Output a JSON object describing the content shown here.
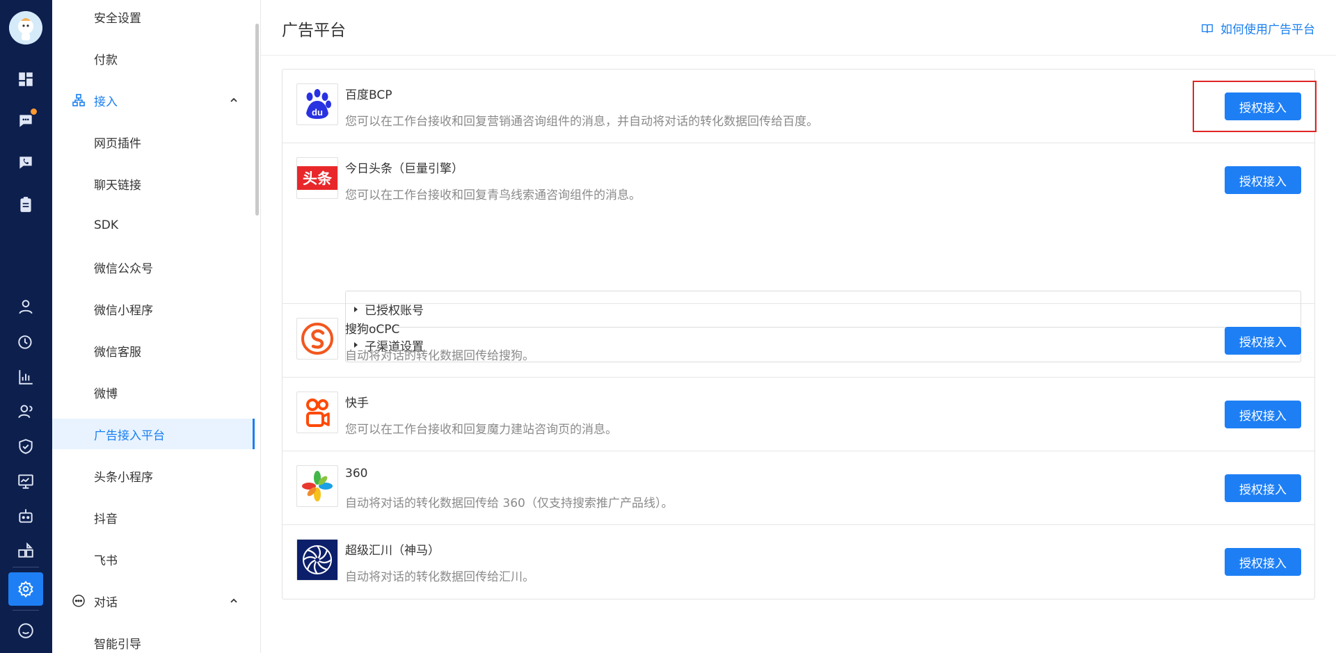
{
  "page": {
    "title": "广告平台",
    "help_link": "如何使用广告平台"
  },
  "sidebar": {
    "items": [
      {
        "label": "安全设置"
      },
      {
        "label": "付款"
      },
      {
        "label": "接入"
      },
      {
        "label": "网页插件"
      },
      {
        "label": "聊天链接"
      },
      {
        "label": "SDK"
      },
      {
        "label": "微信公众号"
      },
      {
        "label": "微信小程序"
      },
      {
        "label": "微信客服"
      },
      {
        "label": "微博"
      },
      {
        "label": "广告接入平台"
      },
      {
        "label": "头条小程序"
      },
      {
        "label": "抖音"
      },
      {
        "label": "飞书"
      },
      {
        "label": "对话"
      },
      {
        "label": "智能引导"
      }
    ]
  },
  "platforms": [
    {
      "name": "百度BCP",
      "desc": "您可以在工作台接收和回复营销通咨询组件的消息，并自动将对话的转化数据回传给百度。",
      "button": "授权接入",
      "logo_text": "du"
    },
    {
      "name": "今日头条（巨量引擎）",
      "desc": "您可以在工作台接收和回复青鸟线索通咨询组件的消息。",
      "button": "授权接入",
      "logo_text": "头条",
      "sub_items": [
        "已授权账号",
        "子渠道设置"
      ]
    },
    {
      "name": "搜狗oCPC",
      "desc": "自动将对话的转化数据回传给搜狗。",
      "button": "授权接入"
    },
    {
      "name": "快手",
      "desc": "您可以在工作台接收和回复魔力建站咨询页的消息。",
      "button": "授权接入"
    },
    {
      "name": "360",
      "desc": "自动将对话的转化数据回传给 360（仅支持搜索推广产品线）。",
      "button": "授权接入"
    },
    {
      "name": "超级汇川（神马）",
      "desc": "自动将对话的转化数据回传给汇川。",
      "button": "授权接入"
    }
  ],
  "colors": {
    "accent": "#1e7ff5",
    "rail": "#0d1f4d",
    "highlight": "#e02424"
  }
}
